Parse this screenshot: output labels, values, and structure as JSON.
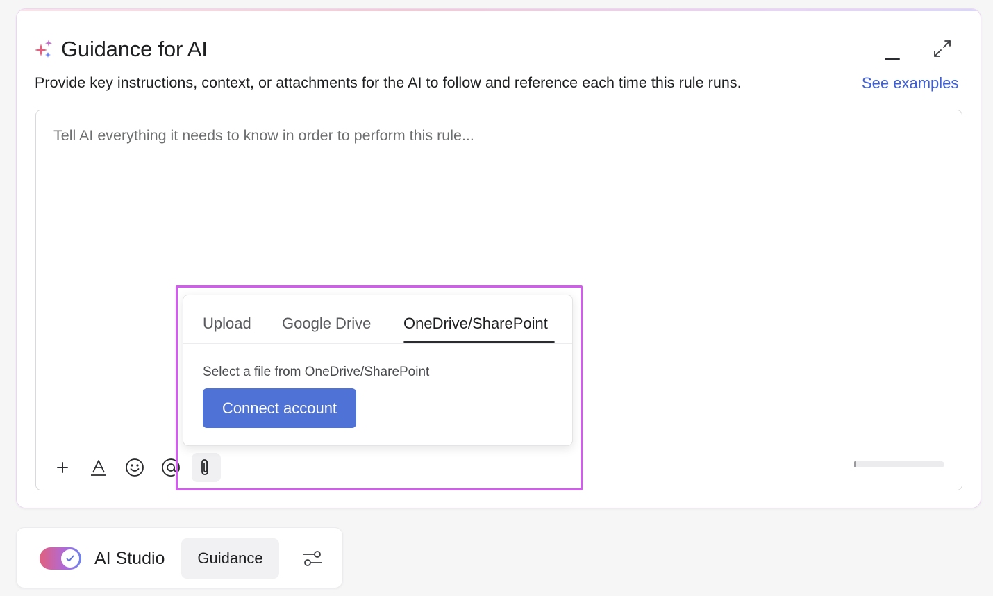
{
  "card": {
    "title": "Guidance for AI",
    "subtitle": "Provide key instructions, context, or attachments for the AI to follow and reference each time this rule runs.",
    "see_examples": "See examples",
    "icons": {
      "title": "sparkle-icon",
      "minimize": "minimize-icon",
      "expand": "expand-icon"
    }
  },
  "editor": {
    "placeholder": "Tell AI everything it needs to know in order to perform this rule...",
    "value": "",
    "toolbar": [
      "plus-icon",
      "text-format-icon",
      "emoji-icon",
      "mention-icon",
      "paperclip-icon"
    ]
  },
  "attach_popover": {
    "tabs": [
      {
        "label": "Upload",
        "active": false
      },
      {
        "label": "Google Drive",
        "active": false
      },
      {
        "label": "OneDrive/SharePoint",
        "active": true
      }
    ],
    "hint": "Select a file from OneDrive/SharePoint",
    "connect_label": "Connect account"
  },
  "bottom_bar": {
    "toggle_on": true,
    "studio_label": "AI Studio",
    "guidance_label": "Guidance",
    "settings_icon": "sliders-icon"
  },
  "colors": {
    "accent_blue": "#4f72d6",
    "link_blue": "#3d5fd8",
    "highlight_magenta": "#d35bf0",
    "text_primary": "#1e1f21"
  }
}
